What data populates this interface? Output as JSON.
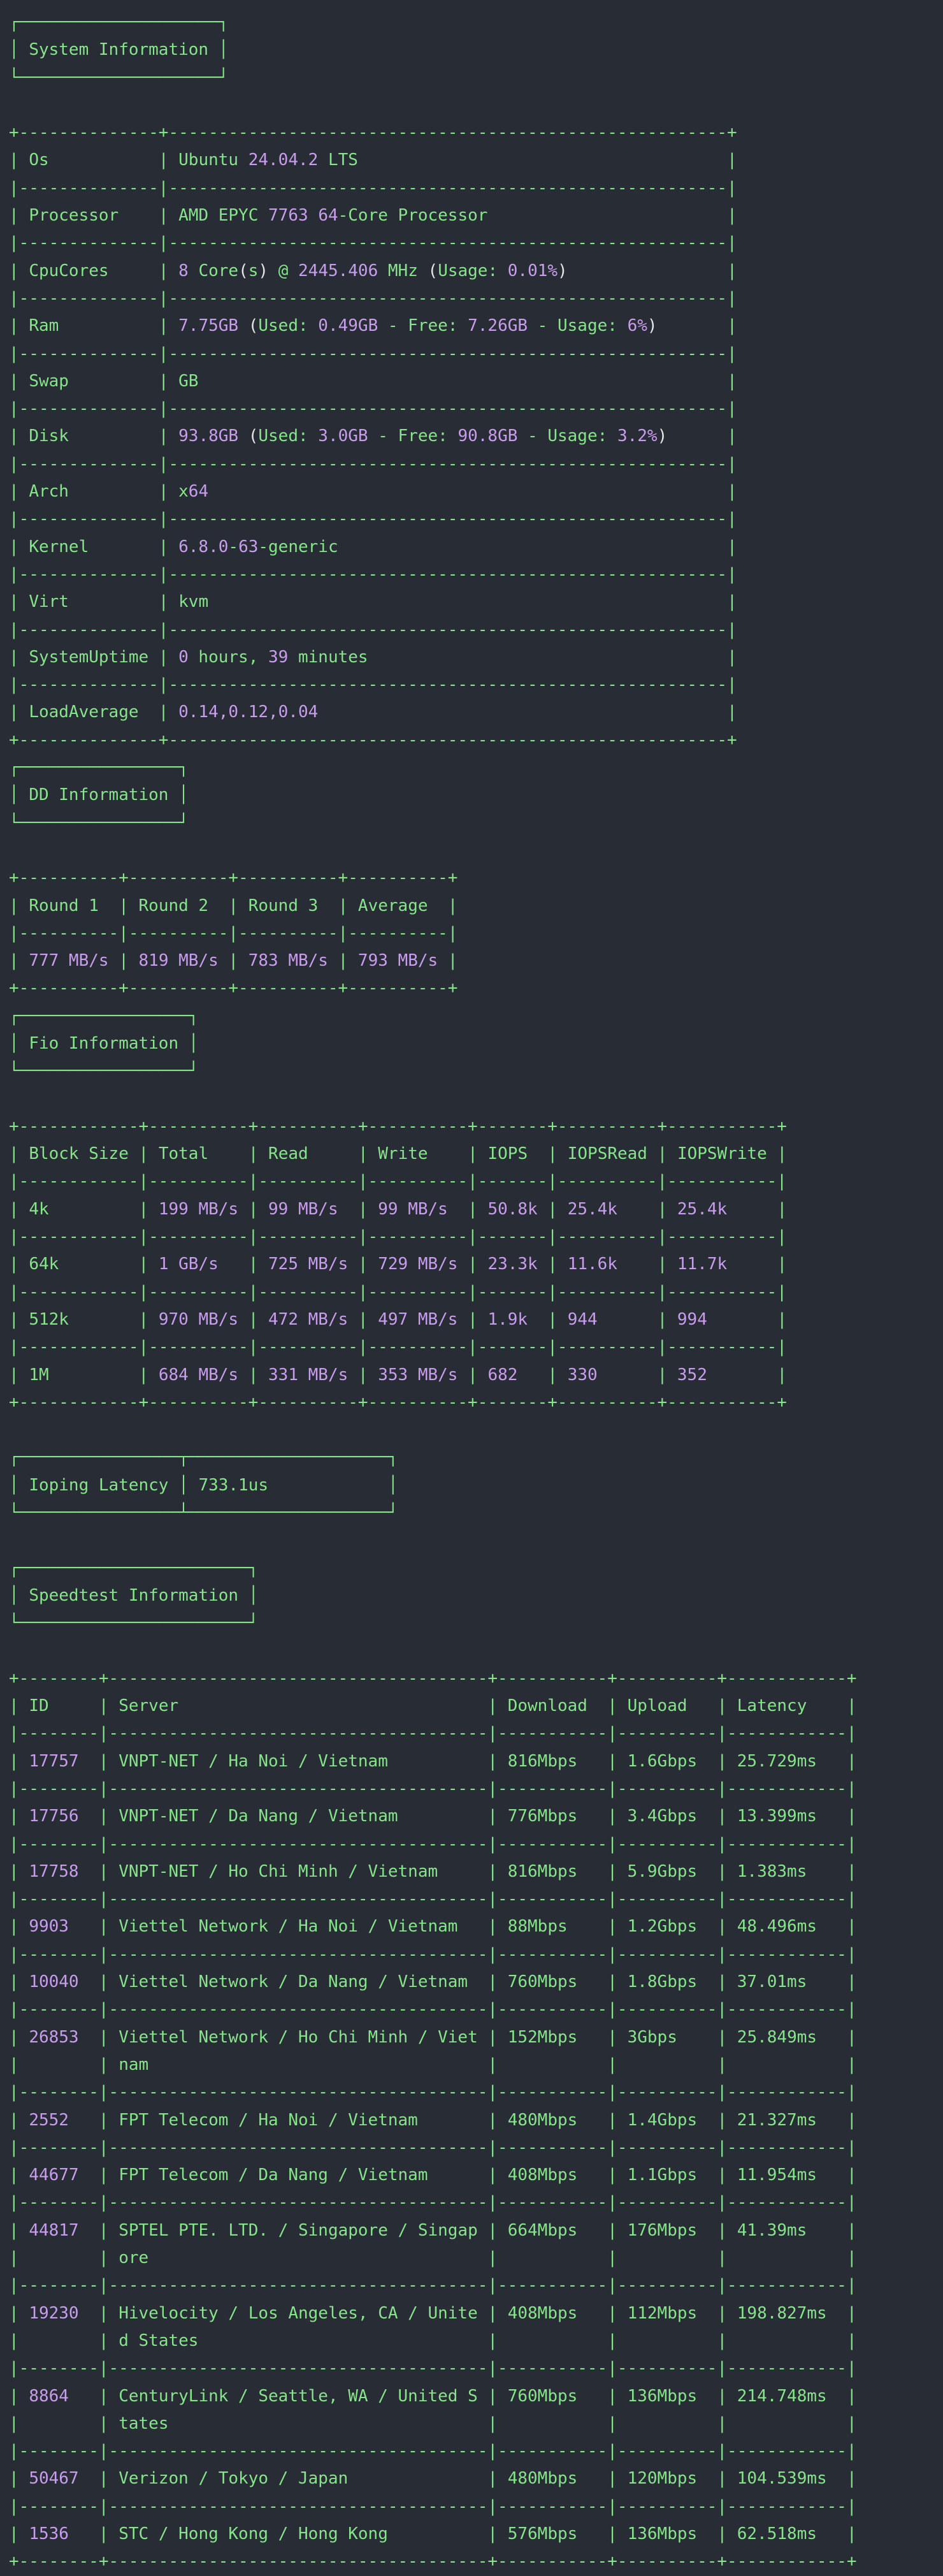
{
  "colors": {
    "background": "#282c34",
    "border": "#86e58a",
    "label": "#86e58a",
    "number": "#c99dee",
    "text": "#e6e6e6"
  },
  "system_information": {
    "title": "System Information",
    "rows": [
      {
        "label": "Os",
        "value": "Ubuntu 24.04.2 LTS"
      },
      {
        "label": "Processor",
        "value": "AMD EPYC 7763 64-Core Processor"
      },
      {
        "label": "CpuCores",
        "value": "8 Core(s) @ 2445.406 MHz (Usage: 0.01%)"
      },
      {
        "label": "Ram",
        "value": "7.75GB (Used: 0.49GB - Free: 7.26GB - Usage: 6%)"
      },
      {
        "label": "Swap",
        "value": "GB"
      },
      {
        "label": "Disk",
        "value": "93.8GB (Used: 3.0GB - Free: 90.8GB - Usage: 3.2%)"
      },
      {
        "label": "Arch",
        "value": "x64"
      },
      {
        "label": "Kernel",
        "value": "6.8.0-63-generic"
      },
      {
        "label": "Virt",
        "value": "kvm"
      },
      {
        "label": "SystemUptime",
        "value": "0 hours, 39 minutes"
      },
      {
        "label": "LoadAverage",
        "value": "0.14,0.12,0.04"
      }
    ]
  },
  "dd_information": {
    "title": "DD Information",
    "headers": [
      "Round 1",
      "Round 2",
      "Round 3",
      "Average"
    ],
    "rows": [
      [
        "777 MB/s",
        "819 MB/s",
        "783 MB/s",
        "793 MB/s"
      ]
    ]
  },
  "fio_information": {
    "title": "Fio Information",
    "headers": [
      "Block Size",
      "Total",
      "Read",
      "Write",
      "IOPS",
      "IOPSRead",
      "IOPSWrite"
    ],
    "rows": [
      [
        "4k",
        "199 MB/s",
        "99 MB/s",
        "99 MB/s",
        "50.8k",
        "25.4k",
        "25.4k"
      ],
      [
        "64k",
        "1 GB/s",
        "725 MB/s",
        "729 MB/s",
        "23.3k",
        "11.6k",
        "11.7k"
      ],
      [
        "512k",
        "970 MB/s",
        "472 MB/s",
        "497 MB/s",
        "1.9k",
        "944",
        "994"
      ],
      [
        "1M",
        "684 MB/s",
        "331 MB/s",
        "353 MB/s",
        "682",
        "330",
        "352"
      ]
    ]
  },
  "ioping": {
    "label": "Ioping Latency",
    "value": "733.1us"
  },
  "speedtest_information": {
    "title": "Speedtest Information",
    "headers": [
      "ID",
      "Server",
      "Download",
      "Upload",
      "Latency"
    ],
    "rows": [
      [
        "17757",
        "VNPT-NET / Ha Noi / Vietnam",
        "816Mbps",
        "1.6Gbps",
        "25.729ms"
      ],
      [
        "17756",
        "VNPT-NET / Da Nang / Vietnam",
        "776Mbps",
        "3.4Gbps",
        "13.399ms"
      ],
      [
        "17758",
        "VNPT-NET / Ho Chi Minh / Vietnam",
        "816Mbps",
        "5.9Gbps",
        "1.383ms"
      ],
      [
        "9903",
        "Viettel Network / Ha Noi / Vietnam",
        "88Mbps",
        "1.2Gbps",
        "48.496ms"
      ],
      [
        "10040",
        "Viettel Network / Da Nang / Vietnam",
        "760Mbps",
        "1.8Gbps",
        "37.01ms"
      ],
      [
        "26853",
        "Viettel Network / Ho Chi Minh / Vietnam",
        "152Mbps",
        "3Gbps",
        "25.849ms"
      ],
      [
        "2552",
        "FPT Telecom / Ha Noi / Vietnam",
        "480Mbps",
        "1.4Gbps",
        "21.327ms"
      ],
      [
        "44677",
        "FPT Telecom / Da Nang / Vietnam",
        "408Mbps",
        "1.1Gbps",
        "11.954ms"
      ],
      [
        "44817",
        "SPTEL PTE. LTD. / Singapore / Singapore",
        "664Mbps",
        "176Mbps",
        "41.39ms"
      ],
      [
        "19230",
        "Hivelocity / Los Angeles, CA / United States",
        "408Mbps",
        "112Mbps",
        "198.827ms"
      ],
      [
        "8864",
        "CenturyLink / Seattle, WA / United States",
        "760Mbps",
        "136Mbps",
        "214.748ms"
      ],
      [
        "50467",
        "Verizon / Tokyo / Japan",
        "480Mbps",
        "120Mbps",
        "104.539ms"
      ],
      [
        "1536",
        "STC / Hong Kong / Hong Kong",
        "576Mbps",
        "136Mbps",
        "62.518ms"
      ]
    ]
  }
}
